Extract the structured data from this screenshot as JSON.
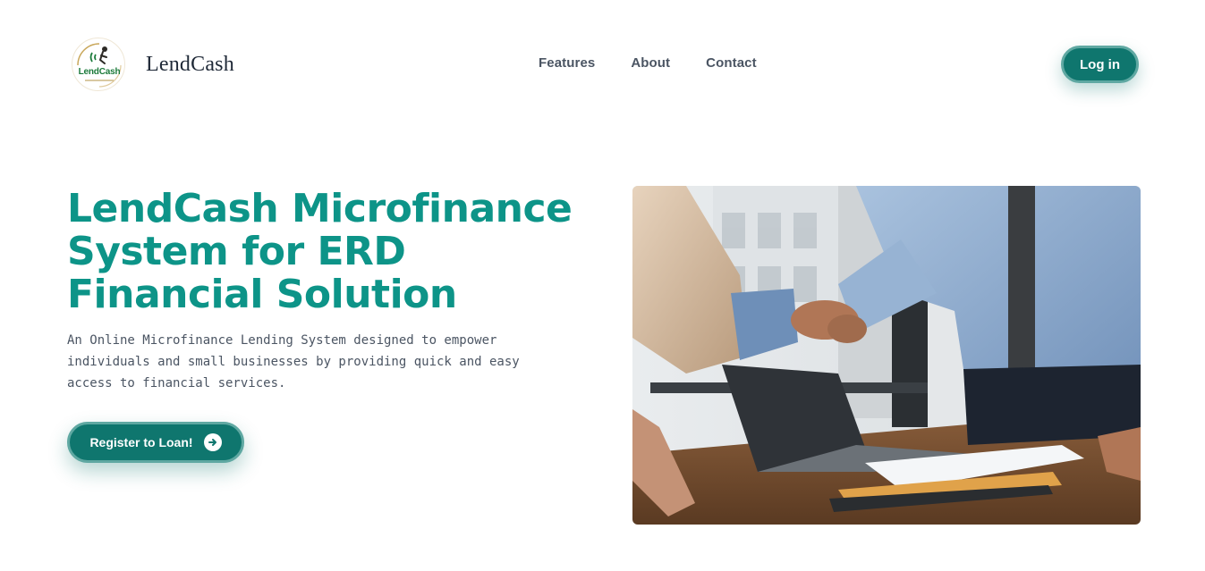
{
  "brand": {
    "logo_text": "LendCash",
    "name": "LendCash"
  },
  "nav": {
    "items": [
      {
        "label": "Features"
      },
      {
        "label": "About"
      },
      {
        "label": "Contact"
      }
    ]
  },
  "header": {
    "login_label": "Log in"
  },
  "hero": {
    "title": "LendCash Microfinance System for ERD Financial Solution",
    "description": "An Online Microfinance Lending System designed to empower individuals and small businesses by providing quick and easy access to financial services.",
    "cta_label": "Register to Loan!",
    "cta_icon": "arrow-right-circle-icon",
    "image": "handshake-photo"
  },
  "colors": {
    "accent": "#0d9488",
    "button": "#0f766e",
    "button_border": "#5fa8a2"
  }
}
